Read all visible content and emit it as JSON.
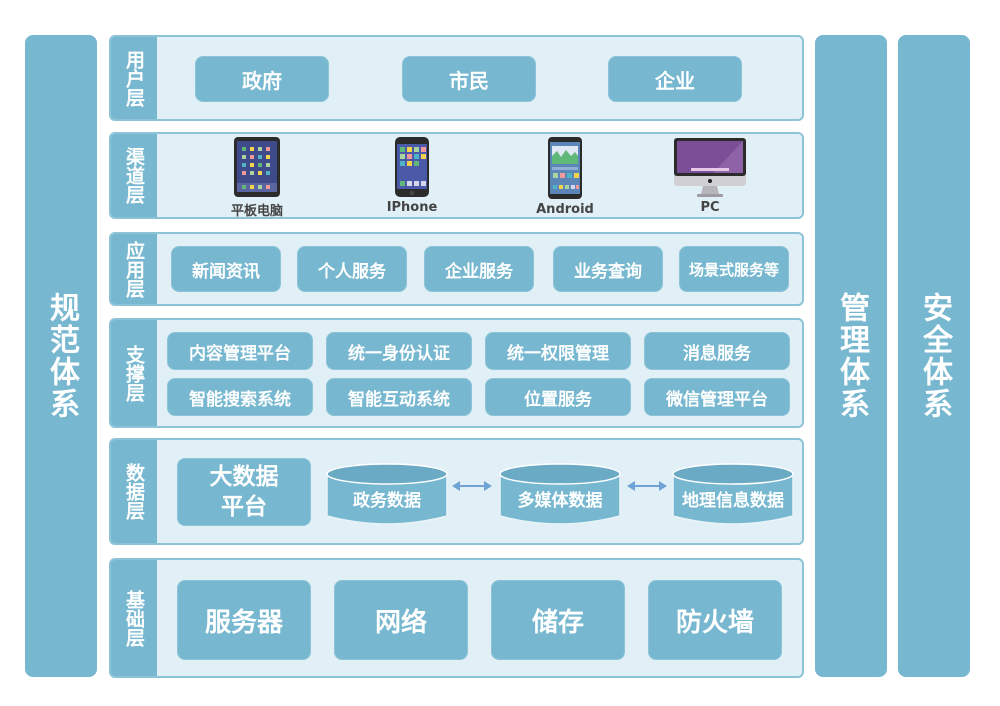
{
  "pillars": {
    "left": "规范体系",
    "management": "管理体系",
    "security": "安全体系"
  },
  "layers": {
    "user": {
      "label": "用户层",
      "items": [
        "政府",
        "市民",
        "企业"
      ]
    },
    "channel": {
      "label": "渠道层",
      "devices": [
        {
          "label": "平板电脑",
          "icon": "tablet-icon"
        },
        {
          "label": "IPhone",
          "icon": "iphone-icon"
        },
        {
          "label": "Android",
          "icon": "android-phone-icon"
        },
        {
          "label": "PC",
          "icon": "desktop-computer-icon"
        }
      ]
    },
    "application": {
      "label": "应用层",
      "items": [
        "新闻资讯",
        "个人服务",
        "企业服务",
        "业务查询",
        "场景式服务等"
      ]
    },
    "support": {
      "label": "支撑层",
      "items": [
        "内容管理平台",
        "统一身份认证",
        "统一权限管理",
        "消息服务",
        "智能搜索系统",
        "智能互动系统",
        "位置服务",
        "微信管理平台"
      ]
    },
    "data": {
      "label": "数据层",
      "platform": "大数据平台",
      "platform_line1": "大数据",
      "platform_line2": "平台",
      "stores": [
        "政务数据",
        "多媒体数据",
        "地理信息数据"
      ]
    },
    "base": {
      "label": "基础层",
      "items": [
        "服务器",
        "网络",
        "储存",
        "防火墙"
      ]
    }
  },
  "colors": {
    "accent": "#77b8d0",
    "layer_bg": "#e1eff6",
    "border": "#8cc3d6",
    "arrow": "#6fa3d8"
  }
}
